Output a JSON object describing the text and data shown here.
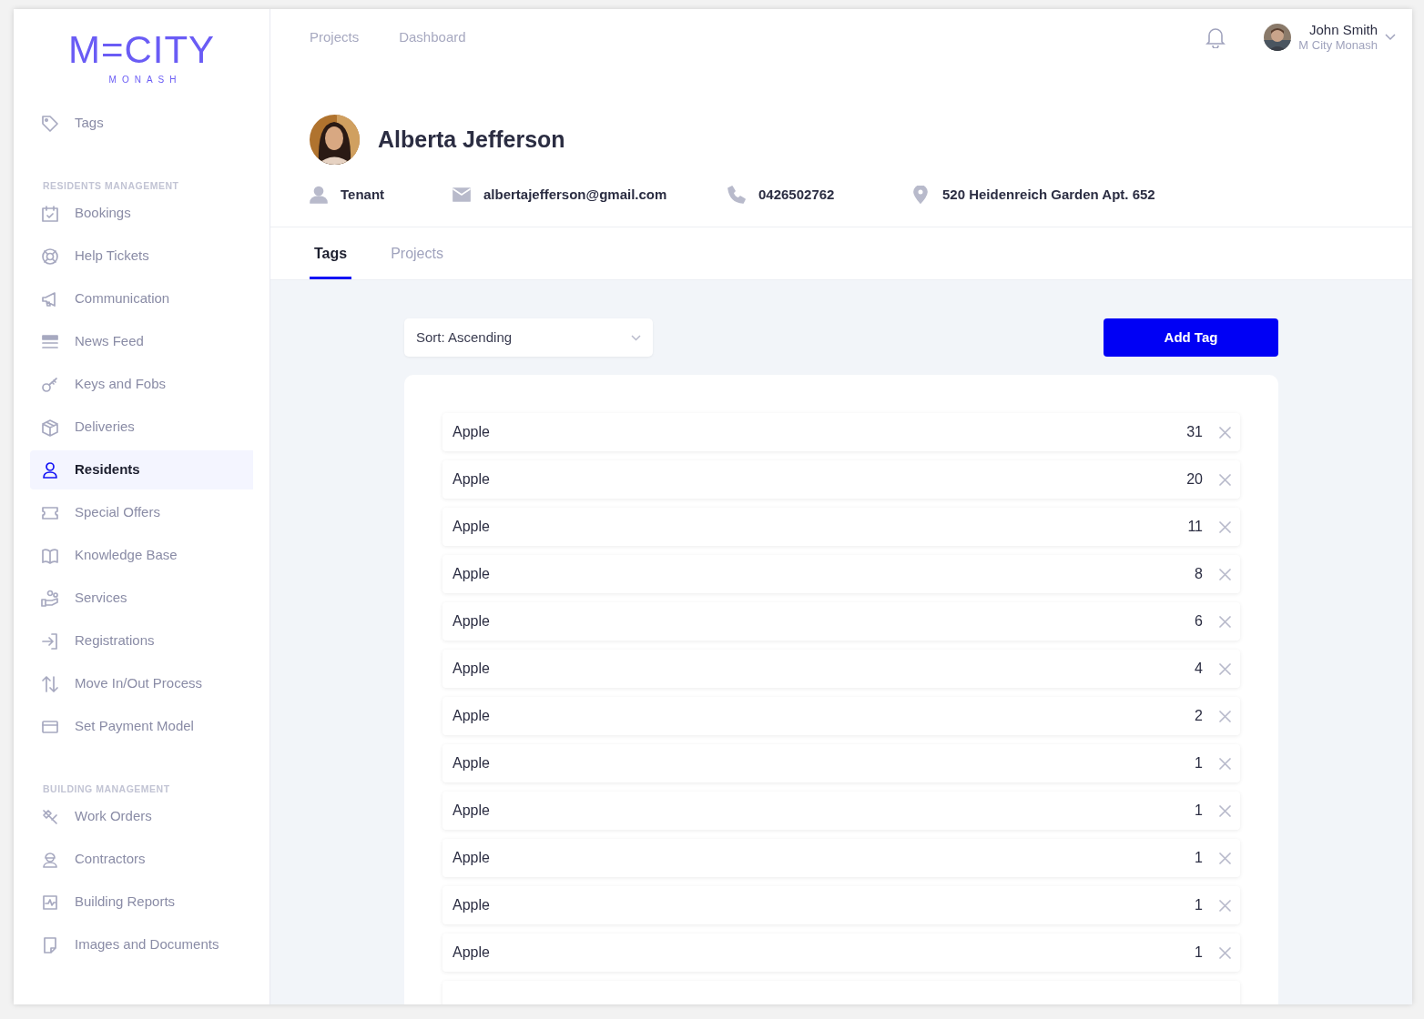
{
  "logo": {
    "wordmark": "M=CITY",
    "subtitle": "MONASH"
  },
  "sidebar": {
    "top_items": [
      {
        "label": "Tags",
        "selected": false
      }
    ],
    "sections": [
      {
        "heading": "RESIDENTS MANAGEMENT",
        "items": [
          {
            "label": "Bookings",
            "selected": false
          },
          {
            "label": "Help Tickets",
            "selected": false
          },
          {
            "label": "Communication",
            "selected": false
          },
          {
            "label": "News Feed",
            "selected": false
          },
          {
            "label": "Keys and Fobs",
            "selected": false
          },
          {
            "label": "Deliveries",
            "selected": false
          },
          {
            "label": "Residents",
            "selected": true
          },
          {
            "label": "Special Offers",
            "selected": false
          },
          {
            "label": "Knowledge Base",
            "selected": false
          },
          {
            "label": "Services",
            "selected": false
          },
          {
            "label": "Registrations",
            "selected": false
          },
          {
            "label": "Move In/Out Process",
            "selected": false
          },
          {
            "label": "Set Payment Model",
            "selected": false
          }
        ]
      },
      {
        "heading": "BUILDING MANAGEMENT",
        "items": [
          {
            "label": "Work Orders",
            "selected": false
          },
          {
            "label": "Contractors",
            "selected": false
          },
          {
            "label": "Building Reports",
            "selected": false
          },
          {
            "label": "Images and Documents",
            "selected": false
          }
        ]
      }
    ]
  },
  "top_nav": [
    "Projects",
    "Dashboard"
  ],
  "user": {
    "name": "John Smith",
    "org": "M City Monash"
  },
  "profile": {
    "name": "Alberta Jefferson",
    "role": "Tenant",
    "email": "albertajefferson@gmail.com",
    "phone": "0426502762",
    "address": "520 Heidenreich Garden Apt. 652"
  },
  "tabs": [
    {
      "label": "Tags",
      "selected": true
    },
    {
      "label": "Projects",
      "selected": false
    }
  ],
  "sort": {
    "value": "Sort: Ascending"
  },
  "add_button": "Add Tag",
  "tags": [
    {
      "name": "Apple",
      "count": "31"
    },
    {
      "name": "Apple",
      "count": "20"
    },
    {
      "name": "Apple",
      "count": "11"
    },
    {
      "name": "Apple",
      "count": "8"
    },
    {
      "name": "Apple",
      "count": "6"
    },
    {
      "name": "Apple",
      "count": "4"
    },
    {
      "name": "Apple",
      "count": "2"
    },
    {
      "name": "Apple",
      "count": "1"
    },
    {
      "name": "Apple",
      "count": "1"
    },
    {
      "name": "Apple",
      "count": "1"
    },
    {
      "name": "Apple",
      "count": "1"
    },
    {
      "name": "Apple",
      "count": "1"
    }
  ]
}
